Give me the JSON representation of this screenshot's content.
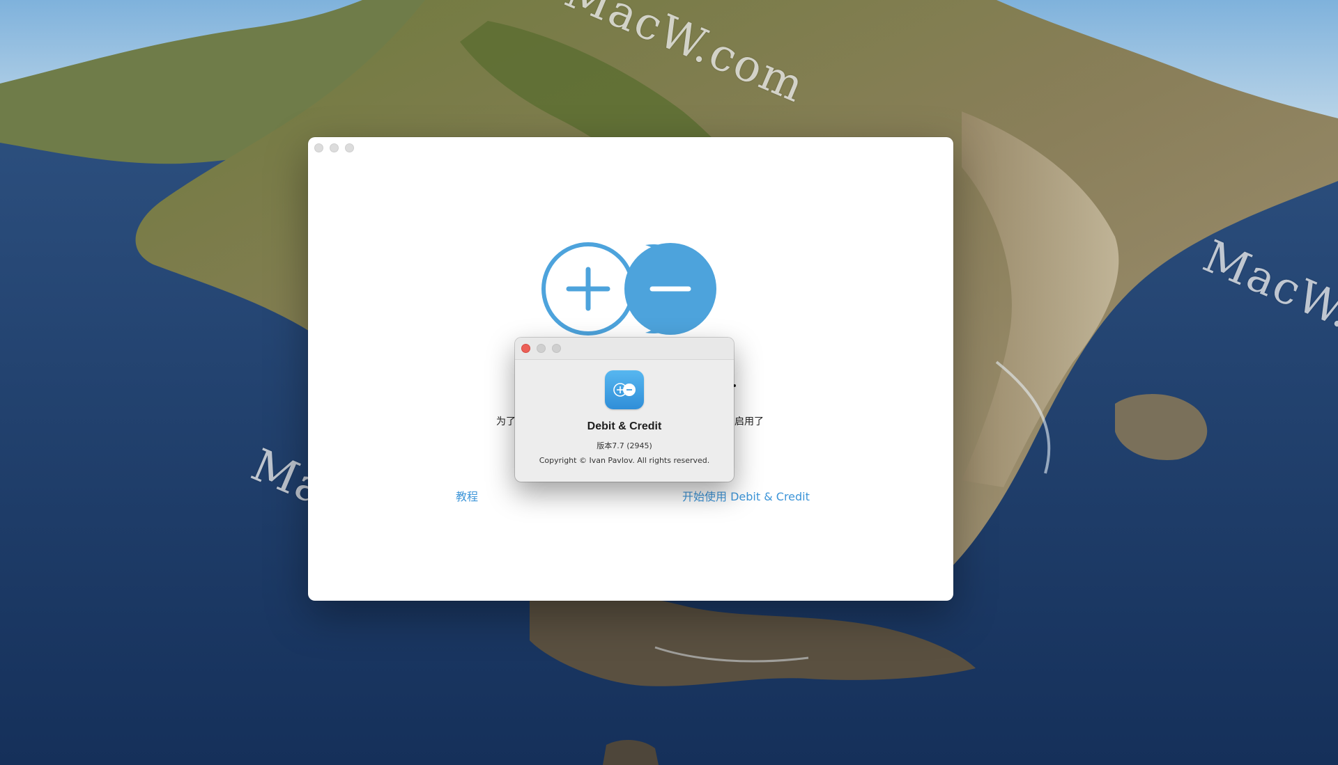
{
  "watermarks": [
    "MacW.com",
    "MacW.com",
    "MacW.c",
    "MacW.com"
  ],
  "main_window": {
    "welcome_left_fragment": "为了",
    "welcome_right_fragment": "启用了",
    "tutorial_link": "教程",
    "start_link": "开始使用 Debit & Credit"
  },
  "about_dialog": {
    "app_name": "Debit & Credit",
    "version": "版本7.7 (2945)",
    "copyright": "Copyright © Ivan Pavlov. All rights reserved."
  },
  "colors": {
    "accent": "#3d95d8",
    "close_button": "#ec5f57"
  },
  "icons": [
    "plus-circle-icon",
    "minus-circle-icon",
    "app-icon"
  ]
}
